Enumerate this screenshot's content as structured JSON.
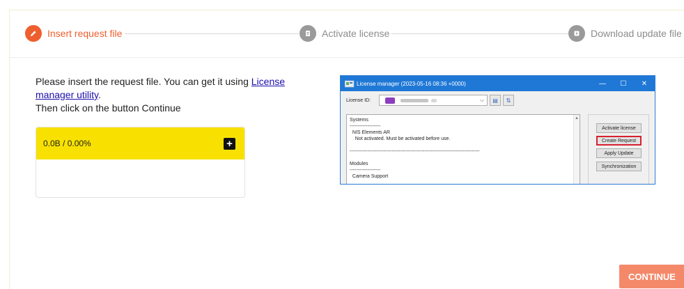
{
  "stepper": {
    "steps": [
      {
        "label": "Insert request file",
        "state": "active",
        "icon": "pencil-icon"
      },
      {
        "label": "Activate license",
        "state": "inactive",
        "icon": "document-icon"
      },
      {
        "label": "Download update file",
        "state": "inactive",
        "icon": "download-icon"
      }
    ]
  },
  "instructions": {
    "line1_prefix": "Please insert the request file. You can get it using ",
    "link_text": "License manager utility",
    "line1_suffix": ".",
    "line2": "Then click on the button Continue"
  },
  "upload": {
    "status": "0.0B / 0.00%",
    "add_icon": "plus-icon"
  },
  "license_manager": {
    "title": "License manager (2023-05-16 08:36 +0000)",
    "license_id_label": "License ID:",
    "content_lines": [
      "Systems",
      "-------------------",
      "  NIS Elements AR",
      "    Not activated. Must be activated before use.",
      "",
      "--------------------------------------------------------------------------------",
      "",
      "Modules",
      "-------------------",
      "  Camera Support"
    ],
    "buttons": [
      {
        "label": "Activate license",
        "highlighted": false
      },
      {
        "label": "Create Request",
        "highlighted": true
      },
      {
        "label": "Apply Update",
        "highlighted": false
      },
      {
        "label": "Synchronization",
        "highlighted": false
      }
    ]
  },
  "actions": {
    "continue_label": "CONTINUE"
  },
  "colors": {
    "accent": "#ee5e2e",
    "upload_bar": "#f8e100",
    "continue_bg": "#f4896a",
    "window_titlebar": "#1f78d6"
  }
}
